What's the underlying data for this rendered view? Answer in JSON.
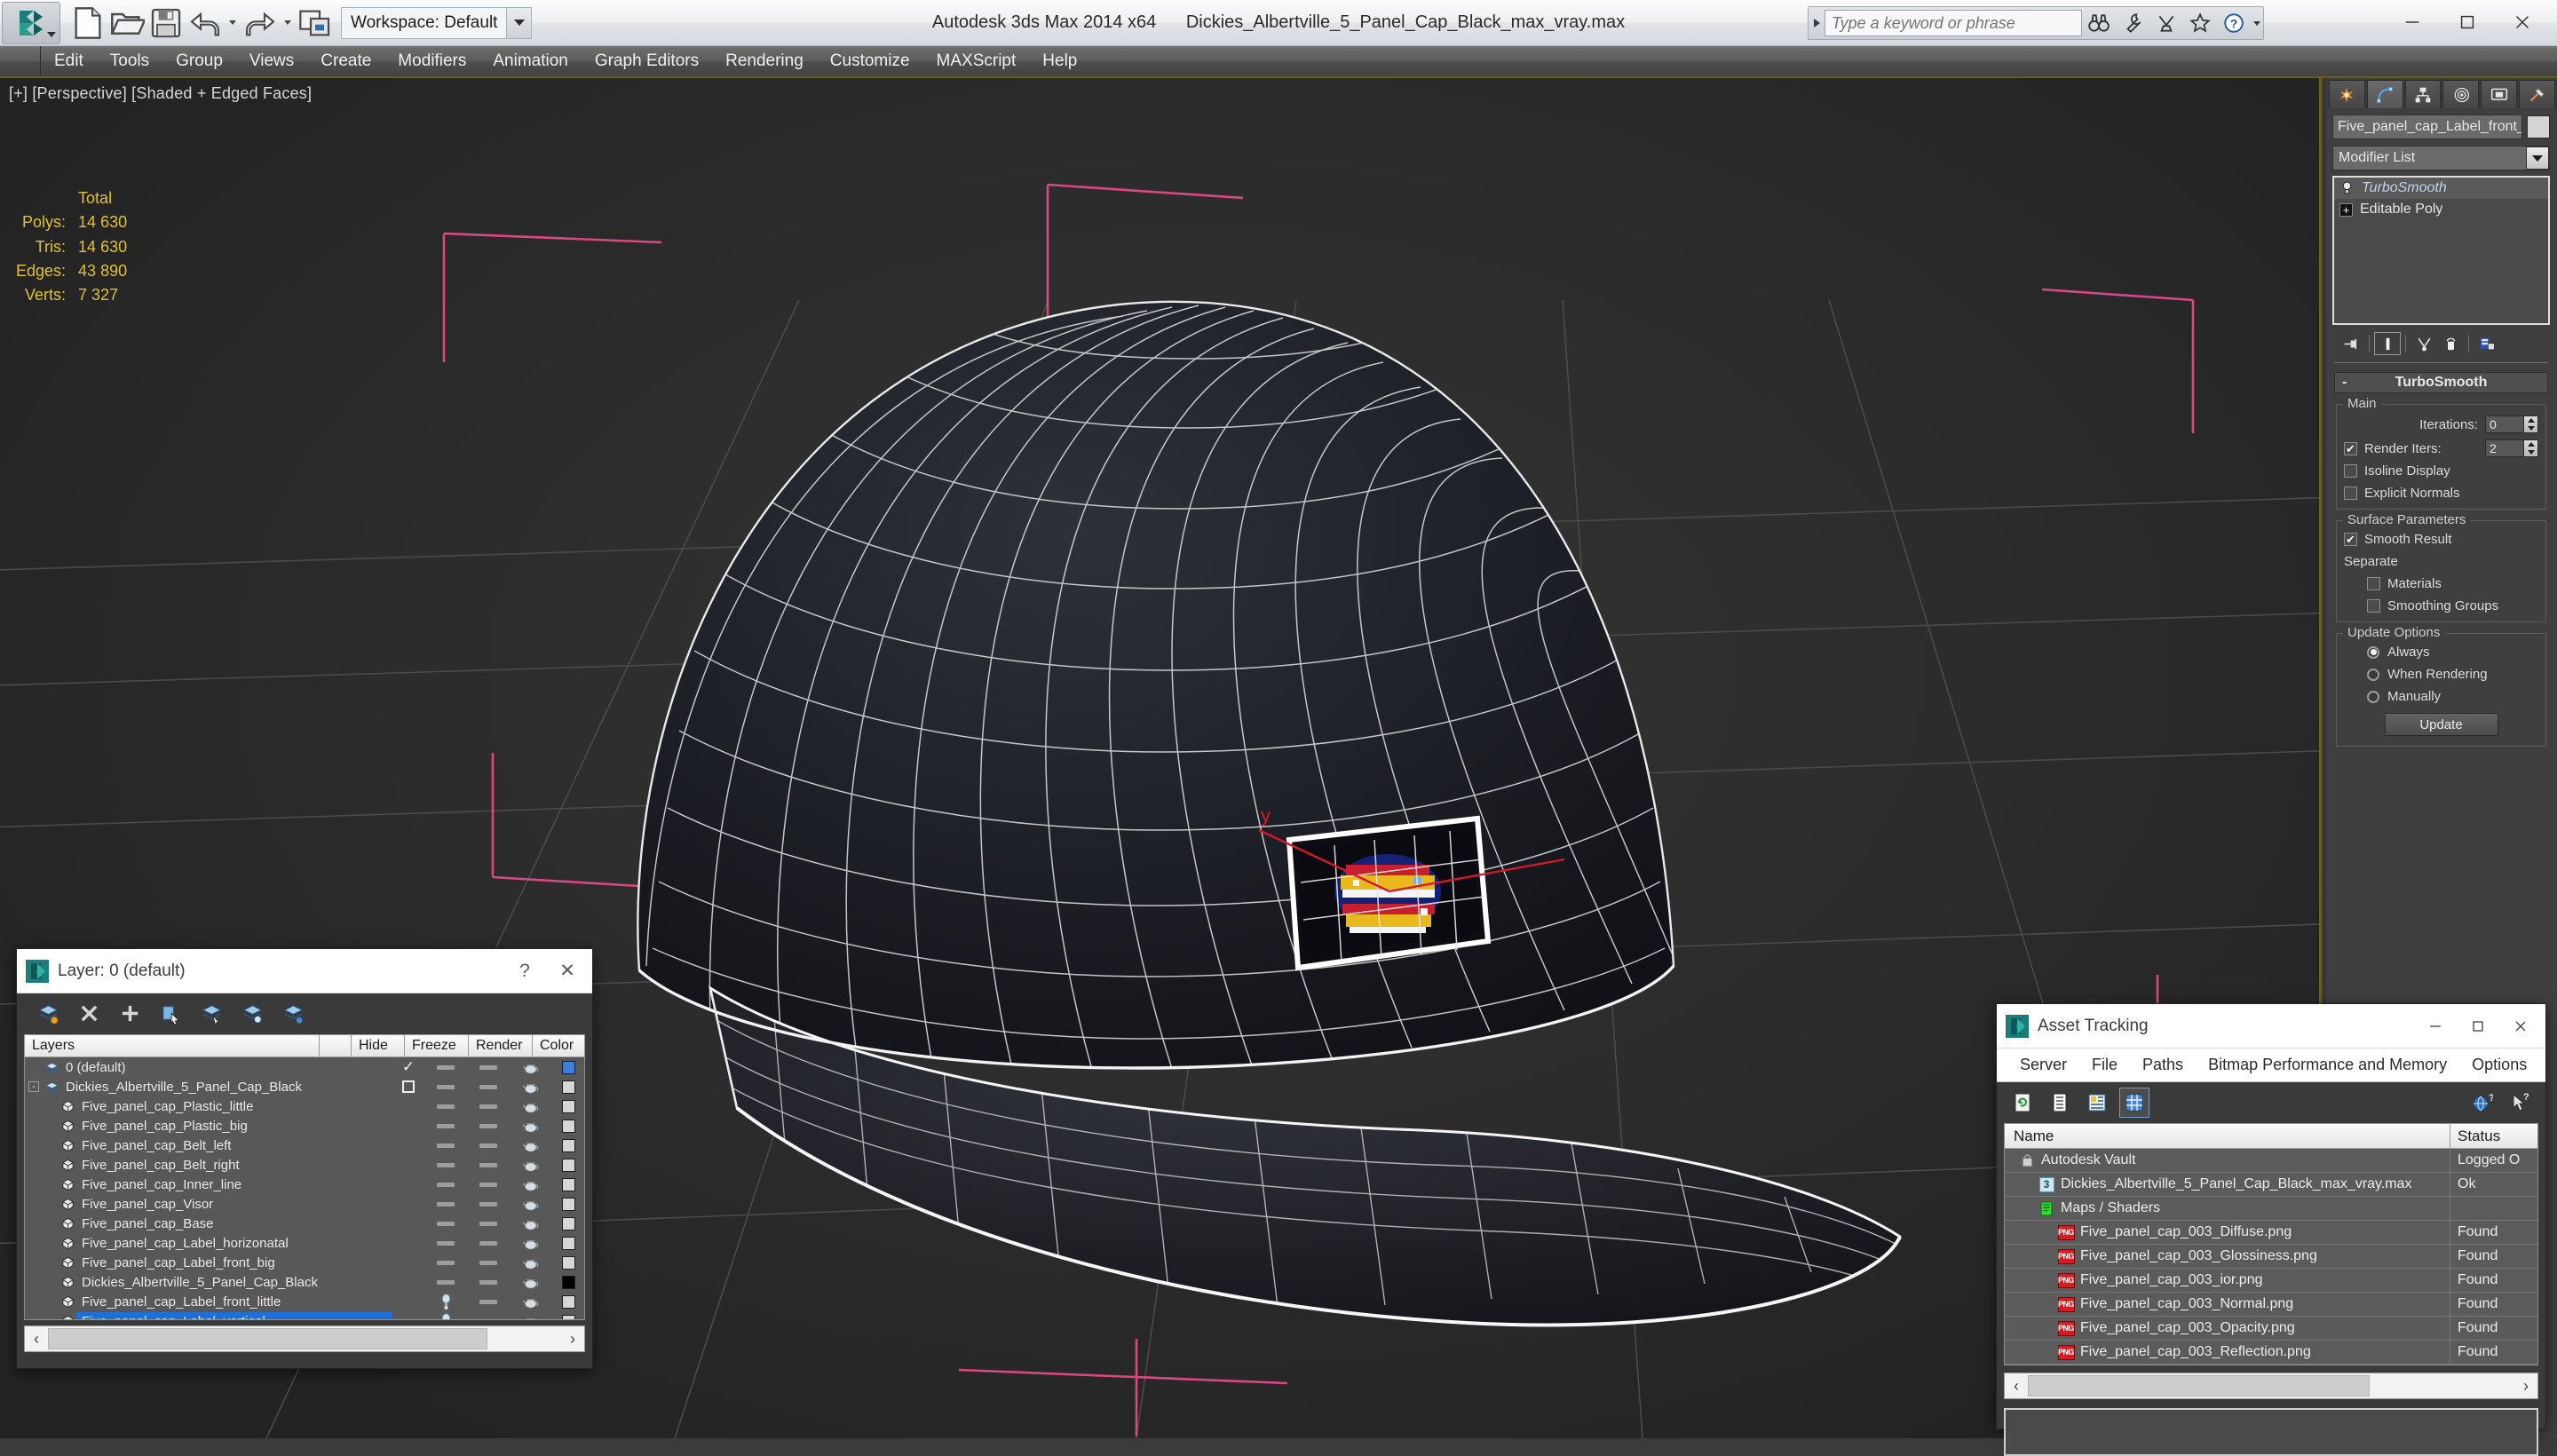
{
  "titlebar": {
    "workspace_label": "Workspace: Default",
    "app_title": "Autodesk 3ds Max  2014 x64",
    "file_title": "Dickies_Albertville_5_Panel_Cap_Black_max_vray.max",
    "search_placeholder": "Type a keyword or phrase",
    "quick_access": [
      "new-file",
      "open-file",
      "save-file",
      "undo",
      "redo",
      "project-folder"
    ],
    "window_buttons": [
      "minimize",
      "maximize",
      "close"
    ]
  },
  "menu": {
    "items": [
      "Edit",
      "Tools",
      "Group",
      "Views",
      "Create",
      "Modifiers",
      "Animation",
      "Graph Editors",
      "Rendering",
      "Customize",
      "MAXScript",
      "Help"
    ]
  },
  "viewport": {
    "label": "[+] [Perspective] [Shaded + Edged Faces]",
    "stats_header": "Total",
    "stats": [
      {
        "name": "Polys:",
        "value": "14 630"
      },
      {
        "name": "Tris:",
        "value": "14 630"
      },
      {
        "name": "Edges:",
        "value": "43 890"
      },
      {
        "name": "Verts:",
        "value": "7 327"
      }
    ],
    "stats_color": "#e0c132",
    "background_color": "#2b2b2b",
    "gizmo_axis_y": "y"
  },
  "command_panel": {
    "tabs": [
      "create-tab",
      "modify-tab",
      "hierarchy-tab",
      "motion-tab",
      "display-tab",
      "utilities-tab"
    ],
    "active_tab_index": 1,
    "object_name": "Five_panel_cap_Label_front_",
    "object_color": "#d4d4d4",
    "modifier_list_label": "Modifier List",
    "stack": [
      {
        "label": "TurboSmooth",
        "selected": true,
        "icon": "lightbulb-icon"
      },
      {
        "label": "Editable Poly",
        "selected": false,
        "icon": "plus-box-icon"
      }
    ],
    "stack_tools": [
      "pin-stack-icon",
      "show-end-result-icon",
      "make-unique-icon",
      "remove-modifier-icon",
      "configure-sets-icon"
    ],
    "rollout": {
      "title": "TurboSmooth",
      "collapse_sign": "-",
      "main_group": "Main",
      "iterations_label": "Iterations:",
      "iterations_value": "0",
      "render_iters_label": "Render Iters:",
      "render_iters_value": "2",
      "render_iters_checked": true,
      "isoline_label": "Isoline Display",
      "isoline_checked": false,
      "explicit_normals_label": "Explicit Normals",
      "explicit_normals_checked": false,
      "surface_group": "Surface Parameters",
      "smooth_result_label": "Smooth Result",
      "smooth_result_checked": true,
      "separate_label": "Separate",
      "materials_label": "Materials",
      "materials_checked": false,
      "smoothing_groups_label": "Smoothing Groups",
      "smoothing_groups_checked": false,
      "update_group": "Update Options",
      "update_options": [
        {
          "label": "Always",
          "selected": true
        },
        {
          "label": "When Rendering",
          "selected": false
        },
        {
          "label": "Manually",
          "selected": false
        }
      ],
      "update_button": "Update"
    }
  },
  "layer_dialog": {
    "title": "Layer: 0 (default)",
    "help_label": "?",
    "close_label": "✕",
    "toolbar": [
      "create-new-layer-icon",
      "delete-layer-icon",
      "add-selection-icon",
      "select-objects-icon",
      "select-highlighted-icon",
      "highlight-selected-icon",
      "layer-properties-icon"
    ],
    "columns": [
      "Layers",
      "",
      "Hide",
      "Freeze",
      "Render",
      "Color"
    ],
    "rows": [
      {
        "name": "0 (default)",
        "depth": 0,
        "icon": "layer-icon",
        "mark": "check",
        "hide": "dash",
        "freeze": "dash",
        "render": "teapot",
        "color": "#3f7fd6",
        "selected": false,
        "expander": ""
      },
      {
        "name": "Dickies_Albertville_5_Panel_Cap_Black",
        "depth": 0,
        "icon": "layer-icon",
        "mark": "box",
        "hide": "dash",
        "freeze": "dash",
        "render": "teapot",
        "color": "#d6d6d6",
        "selected": false,
        "expander": "-"
      },
      {
        "name": "Five_panel_cap_Plastic_little",
        "depth": 1,
        "icon": "object-icon",
        "mark": "",
        "hide": "dash",
        "freeze": "dash",
        "render": "teapot",
        "color": "#d6d6d6",
        "selected": false,
        "expander": ""
      },
      {
        "name": "Five_panel_cap_Plastic_big",
        "depth": 1,
        "icon": "object-icon",
        "mark": "",
        "hide": "dash",
        "freeze": "dash",
        "render": "teapot",
        "color": "#d6d6d6",
        "selected": false,
        "expander": ""
      },
      {
        "name": "Five_panel_cap_Belt_left",
        "depth": 1,
        "icon": "object-icon",
        "mark": "",
        "hide": "dash",
        "freeze": "dash",
        "render": "teapot",
        "color": "#d6d6d6",
        "selected": false,
        "expander": ""
      },
      {
        "name": "Five_panel_cap_Belt_right",
        "depth": 1,
        "icon": "object-icon",
        "mark": "",
        "hide": "dash",
        "freeze": "dash",
        "render": "teapot",
        "color": "#d6d6d6",
        "selected": false,
        "expander": ""
      },
      {
        "name": "Five_panel_cap_Inner_line",
        "depth": 1,
        "icon": "object-icon",
        "mark": "",
        "hide": "dash",
        "freeze": "dash",
        "render": "teapot",
        "color": "#d6d6d6",
        "selected": false,
        "expander": ""
      },
      {
        "name": "Five_panel_cap_Visor",
        "depth": 1,
        "icon": "object-icon",
        "mark": "",
        "hide": "dash",
        "freeze": "dash",
        "render": "teapot",
        "color": "#d6d6d6",
        "selected": false,
        "expander": ""
      },
      {
        "name": "Five_panel_cap_Base",
        "depth": 1,
        "icon": "object-icon",
        "mark": "",
        "hide": "dash",
        "freeze": "dash",
        "render": "teapot",
        "color": "#d6d6d6",
        "selected": false,
        "expander": ""
      },
      {
        "name": "Five_panel_cap_Label_horizonatal",
        "depth": 1,
        "icon": "object-icon",
        "mark": "",
        "hide": "dash",
        "freeze": "dash",
        "render": "teapot",
        "color": "#d6d6d6",
        "selected": false,
        "expander": ""
      },
      {
        "name": "Five_panel_cap_Label_front_big",
        "depth": 1,
        "icon": "object-icon",
        "mark": "",
        "hide": "dash",
        "freeze": "dash",
        "render": "teapot",
        "color": "#d6d6d6",
        "selected": false,
        "expander": ""
      },
      {
        "name": "Dickies_Albertville_5_Panel_Cap_Black",
        "depth": 1,
        "icon": "object-icon",
        "mark": "",
        "hide": "dash",
        "freeze": "dash",
        "render": "teapot",
        "color": "#000000",
        "selected": false,
        "expander": ""
      },
      {
        "name": "Five_panel_cap_Label_front_little",
        "depth": 1,
        "icon": "object-icon",
        "mark": "",
        "hide": "bulb",
        "freeze": "dash",
        "render": "teapot",
        "color": "#d6d6d6",
        "selected": false,
        "expander": ""
      },
      {
        "name": "Five_panel_cap_Label_vertical",
        "depth": 1,
        "icon": "object-icon",
        "mark": "",
        "hide": "bulb",
        "freeze": "dash",
        "render": "teapot",
        "color": "#d6d6d6",
        "selected": true,
        "expander": ""
      }
    ],
    "selection_color": "#1e6fd9"
  },
  "asset_dialog": {
    "title": "Asset Tracking",
    "window_buttons": [
      "minimize",
      "maximize",
      "close"
    ],
    "menu": [
      "Server",
      "File",
      "Paths",
      "Bitmap Performance and Memory",
      "Options"
    ],
    "toolbar": [
      "refresh-icon",
      "list-view-icon",
      "details-view-icon",
      "grid-view-icon"
    ],
    "toolbar_right": [
      "help-globe-icon",
      "help-cursor-icon"
    ],
    "active_toolbar_index": 3,
    "columns": [
      "Name",
      "Status"
    ],
    "rows": [
      {
        "name": "Autodesk Vault",
        "status": "Logged O",
        "depth": 0,
        "icon": "vault-icon"
      },
      {
        "name": "Dickies_Albertville_5_Panel_Cap_Black_max_vray.max",
        "status": "Ok",
        "depth": 1,
        "icon": "max-file-icon"
      },
      {
        "name": "Maps / Shaders",
        "status": "",
        "depth": 1,
        "icon": "maps-icon"
      },
      {
        "name": "Five_panel_cap_003_Diffuse.png",
        "status": "Found",
        "depth": 2,
        "icon": "png-icon"
      },
      {
        "name": "Five_panel_cap_003_Glossiness.png",
        "status": "Found",
        "depth": 2,
        "icon": "png-icon"
      },
      {
        "name": "Five_panel_cap_003_ior.png",
        "status": "Found",
        "depth": 2,
        "icon": "png-icon"
      },
      {
        "name": "Five_panel_cap_003_Normal.png",
        "status": "Found",
        "depth": 2,
        "icon": "png-icon"
      },
      {
        "name": "Five_panel_cap_003_Opacity.png",
        "status": "Found",
        "depth": 2,
        "icon": "png-icon"
      },
      {
        "name": "Five_panel_cap_003_Reflection.png",
        "status": "Found",
        "depth": 2,
        "icon": "png-icon"
      }
    ]
  }
}
